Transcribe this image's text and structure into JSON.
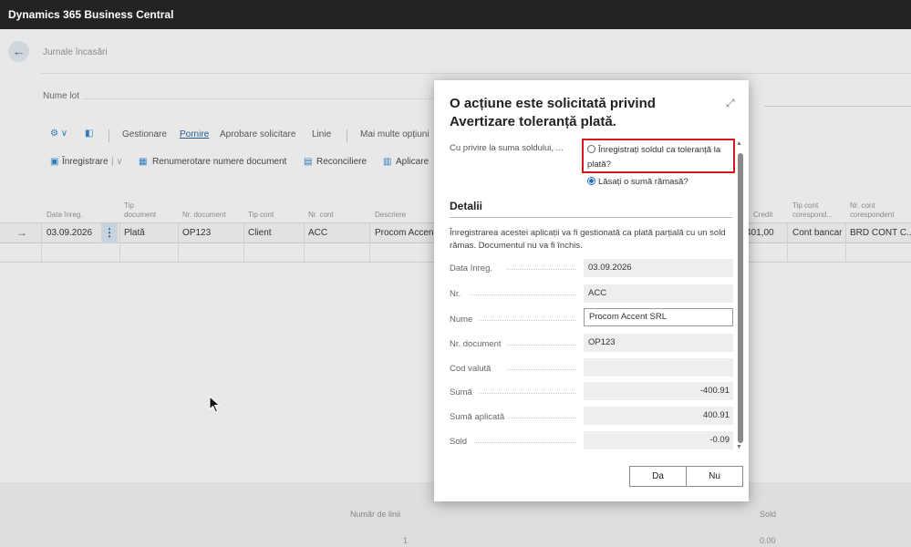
{
  "app": {
    "title": "Dynamics 365 Business Central"
  },
  "page": {
    "breadcrumb": "Jurnale încasări",
    "batch_label": "Nume lot",
    "menu": [
      "Gestionare",
      "Pornire",
      "Aprobare solicitare",
      "Linie",
      "Mai multe opțiuni"
    ],
    "menu_active": "Pornire",
    "actions": [
      "Înregistrare",
      "Renumerotare numere document",
      "Reconciliere",
      "Aplicare"
    ],
    "columns": {
      "date": "Data înreg.",
      "doc_type": "Tip document",
      "doc_no": "Nr. document",
      "acc_type": "Tip cont",
      "acc_no": "Nr. cont",
      "desc": "Descriere",
      "credit": "Credit",
      "bal_acc_type": "Tip cont corespond...",
      "bal_acc_no": "Nr. cont corespondent"
    },
    "row": {
      "date": "03.09.2026",
      "doc_type": "Plată",
      "doc_no": "OP123",
      "acc_type": "Client",
      "acc_no": "ACC",
      "desc": "Procom Accent",
      "credit": "401,00",
      "bal_acc_type": "Cont bancar",
      "bal_acc_no": "BRD CONT C..."
    },
    "footer": {
      "lines_label": "Număr de linii",
      "lines_value": "1",
      "balance_label": "Sold",
      "balance_value": "0.00"
    }
  },
  "dialog": {
    "title": "O acțiune este solicitată privind Avertizare toleranță plată.",
    "question_label": "Cu privire la suma soldului, ...",
    "option1": "Înregistrați soldul ca toleranță la plată?",
    "option2": "Lăsați o sumă rămasă?",
    "selected_option": "option2",
    "section_title": "Detalii",
    "description": "Înregistrarea acestei aplicații va fi gestionată ca plată parțială cu un sold rămas. Documentul nu va fi închis.",
    "fields": {
      "posting_date": {
        "label": "Data înreg.",
        "value": "03.09.2026"
      },
      "no": {
        "label": "Nr.",
        "value": "ACC"
      },
      "name": {
        "label": "Nume",
        "value": "Procom Accent SRL"
      },
      "doc_no": {
        "label": "Nr. document",
        "value": "OP123"
      },
      "currency": {
        "label": "Cod valută",
        "value": ""
      },
      "amount": {
        "label": "Sumă",
        "value": "-400.91"
      },
      "applied_amount": {
        "label": "Sumă aplicată",
        "value": "400.91"
      },
      "balance": {
        "label": "Sold",
        "value": "-0.09"
      }
    },
    "yes_label": "Da",
    "no_label": "Nu"
  }
}
